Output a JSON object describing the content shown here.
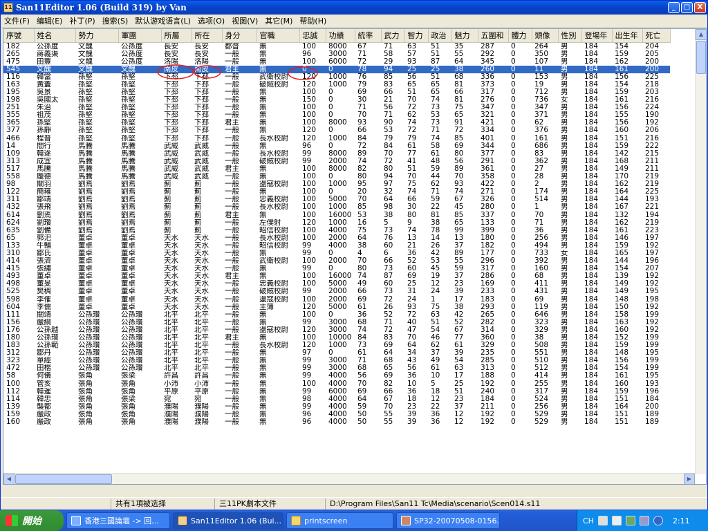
{
  "window": {
    "title": "San11Editor 1.06 (Build 319) by Van",
    "icon_text": "11",
    "buttons": [
      "_",
      "□",
      "X"
    ]
  },
  "menu": [
    "文件(F)",
    "编辑(E)",
    "补丁(P)",
    "搜索(S)",
    "默认游戏语言(L)",
    "选项(O)",
    "视图(V)",
    "其它(M)",
    "帮助(H)"
  ],
  "columns": [
    "序號",
    "姓名",
    "勢力",
    "軍團",
    "所屬",
    "所在",
    "身分",
    "官職",
    "忠誠",
    "功績",
    "統率",
    "武力",
    "智力",
    "政治",
    "魅力",
    "五圍和",
    "體力",
    "頭像",
    "性別",
    "登場年",
    "出生年",
    "死亡"
  ],
  "rows": [
    [
      "182",
      "公孫度",
      "文醜",
      "公孫度",
      "長安",
      "長安",
      "都督",
      "無",
      "100",
      "8000",
      "67",
      "71",
      "63",
      "51",
      "35",
      "287",
      "0",
      "264",
      "男",
      "184",
      "154",
      "204"
    ],
    [
      "265",
      "蔣義渠",
      "文醜",
      "公孫度",
      "長安",
      "長安",
      "一般",
      "無",
      "96",
      "3000",
      "71",
      "58",
      "57",
      "51",
      "55",
      "292",
      "0",
      "350",
      "男",
      "184",
      "159",
      "205"
    ],
    [
      "475",
      "田豐",
      "文醜",
      "公孫度",
      "洛陽",
      "洛陽",
      "一般",
      "無",
      "100",
      "6000",
      "72",
      "29",
      "93",
      "87",
      "64",
      "345",
      "0",
      "107",
      "男",
      "184",
      "162",
      "200"
    ],
    [
      "545",
      "文醜",
      "文醜",
      "文醜",
      "南皮",
      "南皮",
      "君主",
      "無",
      "0",
      "0",
      "78",
      "94",
      "25",
      "25",
      "38",
      "260",
      "0",
      "11",
      "男",
      "184",
      "161",
      "200"
    ],
    [
      "116",
      "韓當",
      "孫堅",
      "孫堅",
      "下邳",
      "下邳",
      "一般",
      "武衛校尉",
      "120",
      "1000",
      "76",
      "85",
      "56",
      "51",
      "68",
      "336",
      "0",
      "153",
      "男",
      "184",
      "156",
      "225"
    ],
    [
      "163",
      "黃蓋",
      "孫堅",
      "孫堅",
      "下邳",
      "下邳",
      "一般",
      "破賊校尉",
      "120",
      "1000",
      "79",
      "83",
      "65",
      "65",
      "81",
      "373",
      "0",
      "19",
      "男",
      "184",
      "154",
      "218"
    ],
    [
      "195",
      "吳景",
      "孫堅",
      "孫堅",
      "下邳",
      "下邳",
      "一般",
      "無",
      "100",
      "0",
      "69",
      "66",
      "51",
      "65",
      "66",
      "317",
      "0",
      "712",
      "男",
      "184",
      "159",
      "203"
    ],
    [
      "198",
      "吳國太",
      "孫堅",
      "孫堅",
      "下邳",
      "下邳",
      "一般",
      "無",
      "150",
      "0",
      "30",
      "21",
      "70",
      "74",
      "81",
      "276",
      "0",
      "736",
      "女",
      "184",
      "161",
      "216"
    ],
    [
      "251",
      "朱治",
      "孫堅",
      "孫堅",
      "下邳",
      "下邳",
      "一般",
      "無",
      "100",
      "0",
      "71",
      "56",
      "72",
      "73",
      "75",
      "347",
      "0",
      "347",
      "男",
      "184",
      "156",
      "224"
    ],
    [
      "355",
      "祖茂",
      "孫堅",
      "孫堅",
      "下邳",
      "下邳",
      "一般",
      "無",
      "100",
      "0",
      "70",
      "71",
      "62",
      "53",
      "65",
      "321",
      "0",
      "371",
      "男",
      "184",
      "155",
      "190"
    ],
    [
      "365",
      "孫堅",
      "孫堅",
      "孫堅",
      "下邳",
      "下邳",
      "君主",
      "無",
      "100",
      "8000",
      "93",
      "90",
      "74",
      "73",
      "91",
      "421",
      "0",
      "62",
      "男",
      "184",
      "156",
      "192"
    ],
    [
      "377",
      "孫靜",
      "孫堅",
      "孫堅",
      "下邳",
      "下邳",
      "一般",
      "無",
      "120",
      "0",
      "66",
      "53",
      "72",
      "71",
      "72",
      "334",
      "0",
      "376",
      "男",
      "184",
      "160",
      "206"
    ],
    [
      "466",
      "程普",
      "孫堅",
      "孫堅",
      "下邳",
      "下邳",
      "一般",
      "長水校尉",
      "120",
      "1000",
      "84",
      "79",
      "79",
      "74",
      "85",
      "401",
      "0",
      "161",
      "男",
      "184",
      "151",
      "216"
    ],
    [
      "14",
      "閻行",
      "馬騰",
      "馬騰",
      "武威",
      "武威",
      "一般",
      "無",
      "96",
      "0",
      "72",
      "84",
      "61",
      "58",
      "69",
      "344",
      "0",
      "686",
      "男",
      "184",
      "159",
      "222"
    ],
    [
      "109",
      "韓遂",
      "馬騰",
      "馬騰",
      "武威",
      "武威",
      "一般",
      "長水校尉",
      "99",
      "8000",
      "89",
      "70",
      "77",
      "61",
      "80",
      "377",
      "0",
      "83",
      "男",
      "184",
      "142",
      "215"
    ],
    [
      "313",
      "成宜",
      "馬騰",
      "馬騰",
      "武威",
      "武威",
      "一般",
      "破賊校尉",
      "99",
      "2000",
      "74",
      "72",
      "41",
      "48",
      "56",
      "291",
      "0",
      "362",
      "男",
      "184",
      "168",
      "211"
    ],
    [
      "517",
      "馬騰",
      "馬騰",
      "馬騰",
      "武威",
      "武威",
      "君主",
      "無",
      "100",
      "8000",
      "82",
      "80",
      "51",
      "59",
      "89",
      "361",
      "0",
      "27",
      "男",
      "184",
      "149",
      "211"
    ],
    [
      "558",
      "龐德",
      "馬騰",
      "馬騰",
      "武威",
      "武威",
      "一般",
      "無",
      "100",
      "0",
      "80",
      "94",
      "70",
      "44",
      "70",
      "358",
      "0",
      "28",
      "男",
      "184",
      "170",
      "219"
    ],
    [
      "98",
      "關羽",
      "劉焉",
      "劉焉",
      "薊",
      "薊",
      "一般",
      "盪寇校尉",
      "100",
      "1000",
      "95",
      "97",
      "75",
      "62",
      "93",
      "422",
      "0",
      "2",
      "男",
      "184",
      "162",
      "219"
    ],
    [
      "122",
      "簡雍",
      "劉焉",
      "劉焉",
      "薊",
      "薊",
      "一般",
      "無",
      "100",
      "0",
      "20",
      "32",
      "74",
      "71",
      "74",
      "271",
      "0",
      "174",
      "男",
      "184",
      "164",
      "225"
    ],
    [
      "311",
      "鄒靖",
      "劉焉",
      "劉焉",
      "薊",
      "薊",
      "一般",
      "忠義校尉",
      "100",
      "5000",
      "70",
      "64",
      "66",
      "59",
      "67",
      "326",
      "0",
      "514",
      "男",
      "184",
      "144",
      "193"
    ],
    [
      "432",
      "張飛",
      "劉焉",
      "劉焉",
      "薊",
      "薊",
      "一般",
      "長水校尉",
      "100",
      "1000",
      "85",
      "98",
      "30",
      "22",
      "45",
      "280",
      "0",
      "1",
      "男",
      "184",
      "167",
      "221"
    ],
    [
      "614",
      "劉焉",
      "劉焉",
      "劉焉",
      "薊",
      "薊",
      "君主",
      "無",
      "100",
      "16000",
      "53",
      "38",
      "80",
      "81",
      "85",
      "337",
      "0",
      "70",
      "男",
      "184",
      "132",
      "194"
    ],
    [
      "624",
      "劉瓚",
      "劉焉",
      "劉焉",
      "薊",
      "薊",
      "一般",
      "左僕射",
      "120",
      "1000",
      "16",
      "5",
      "9",
      "38",
      "65",
      "133",
      "0",
      "71",
      "男",
      "184",
      "162",
      "219"
    ],
    [
      "635",
      "劉備",
      "劉焉",
      "劉焉",
      "薊",
      "薊",
      "一般",
      "昭信校尉",
      "100",
      "4000",
      "75",
      "73",
      "74",
      "78",
      "99",
      "399",
      "0",
      "36",
      "男",
      "184",
      "161",
      "223"
    ],
    [
      "65",
      "郭汜",
      "董卓",
      "董卓",
      "天水",
      "天水",
      "一般",
      "長水校尉",
      "100",
      "2000",
      "64",
      "76",
      "13",
      "14",
      "13",
      "180",
      "0",
      "256",
      "男",
      "184",
      "146",
      "197"
    ],
    [
      "133",
      "牛輔",
      "董卓",
      "董卓",
      "天水",
      "天水",
      "一般",
      "昭信校尉",
      "99",
      "4000",
      "38",
      "60",
      "21",
      "26",
      "37",
      "182",
      "0",
      "494",
      "男",
      "184",
      "159",
      "192"
    ],
    [
      "310",
      "鄒氏",
      "董卓",
      "董卓",
      "天水",
      "天水",
      "一般",
      "無",
      "99",
      "0",
      "4",
      "6",
      "36",
      "42",
      "89",
      "177",
      "0",
      "733",
      "女",
      "184",
      "165",
      "197"
    ],
    [
      "414",
      "張濟",
      "董卓",
      "董卓",
      "天水",
      "天水",
      "一般",
      "武衛校尉",
      "100",
      "2000",
      "70",
      "66",
      "52",
      "53",
      "55",
      "296",
      "0",
      "392",
      "男",
      "184",
      "144",
      "196"
    ],
    [
      "415",
      "張繡",
      "董卓",
      "董卓",
      "天水",
      "天水",
      "一般",
      "無",
      "99",
      "0",
      "80",
      "73",
      "60",
      "45",
      "59",
      "317",
      "0",
      "160",
      "男",
      "184",
      "154",
      "207"
    ],
    [
      "493",
      "董卓",
      "董卓",
      "董卓",
      "天水",
      "天水",
      "君主",
      "無",
      "100",
      "16000",
      "74",
      "87",
      "69",
      "19",
      "37",
      "286",
      "0",
      "68",
      "男",
      "184",
      "139",
      "192"
    ],
    [
      "498",
      "董旻",
      "董卓",
      "董卓",
      "天水",
      "天水",
      "一般",
      "忠義校尉",
      "100",
      "5000",
      "49",
      "60",
      "25",
      "12",
      "23",
      "169",
      "0",
      "411",
      "男",
      "184",
      "149",
      "192"
    ],
    [
      "525",
      "樊稠",
      "董卓",
      "董卓",
      "天水",
      "天水",
      "一般",
      "破賊校尉",
      "99",
      "2000",
      "66",
      "73",
      "31",
      "24",
      "39",
      "233",
      "0",
      "431",
      "男",
      "184",
      "149",
      "195"
    ],
    [
      "598",
      "李傕",
      "董卓",
      "董卓",
      "天水",
      "天水",
      "一般",
      "盪寇校尉",
      "100",
      "2000",
      "69",
      "72",
      "24",
      "1",
      "17",
      "183",
      "0",
      "69",
      "男",
      "184",
      "148",
      "198"
    ],
    [
      "604",
      "李儒",
      "董卓",
      "董卓",
      "天水",
      "天水",
      "一般",
      "主簿",
      "120",
      "5000",
      "61",
      "26",
      "93",
      "75",
      "38",
      "293",
      "0",
      "119",
      "男",
      "184",
      "150",
      "192"
    ],
    [
      "111",
      "關靖",
      "公孫瓚",
      "公孫瓚",
      "北平",
      "北平",
      "一般",
      "無",
      "100",
      "0",
      "36",
      "52",
      "72",
      "63",
      "42",
      "265",
      "0",
      "646",
      "男",
      "184",
      "158",
      "199"
    ],
    [
      "156",
      "嚴綱",
      "公孫瓚",
      "公孫瓚",
      "北平",
      "北平",
      "一般",
      "無",
      "99",
      "3000",
      "68",
      "71",
      "40",
      "51",
      "52",
      "282",
      "0",
      "323",
      "男",
      "184",
      "163",
      "192"
    ],
    [
      "176",
      "公孫越",
      "公孫瓚",
      "公孫瓚",
      "北平",
      "北平",
      "一般",
      "盪寇校尉",
      "120",
      "3000",
      "74",
      "72",
      "47",
      "54",
      "67",
      "314",
      "0",
      "329",
      "男",
      "184",
      "160",
      "192"
    ],
    [
      "180",
      "公孫瓚",
      "公孫瓚",
      "公孫瓚",
      "北平",
      "北平",
      "君主",
      "無",
      "100",
      "10000",
      "84",
      "83",
      "70",
      "46",
      "77",
      "360",
      "0",
      "38",
      "男",
      "184",
      "152",
      "199"
    ],
    [
      "183",
      "公孫範",
      "公孫瓚",
      "公孫瓚",
      "北平",
      "北平",
      "一般",
      "長水校尉",
      "120",
      "1000",
      "73",
      "69",
      "64",
      "62",
      "61",
      "329",
      "0",
      "508",
      "男",
      "184",
      "159",
      "199"
    ],
    [
      "312",
      "鄒丹",
      "公孫瓚",
      "公孫瓚",
      "北平",
      "北平",
      "一般",
      "無",
      "97",
      "0",
      "61",
      "64",
      "34",
      "37",
      "39",
      "235",
      "0",
      "551",
      "男",
      "184",
      "148",
      "195"
    ],
    [
      "323",
      "單經",
      "公孫瓚",
      "公孫瓚",
      "北平",
      "北平",
      "一般",
      "無",
      "99",
      "3000",
      "71",
      "68",
      "43",
      "49",
      "54",
      "285",
      "0",
      "510",
      "男",
      "184",
      "156",
      "199"
    ],
    [
      "472",
      "田楷",
      "公孫瓚",
      "公孫瓚",
      "北平",
      "北平",
      "一般",
      "無",
      "99",
      "3000",
      "68",
      "65",
      "56",
      "61",
      "63",
      "313",
      "0",
      "512",
      "男",
      "184",
      "154",
      "199"
    ],
    [
      "58",
      "何儀",
      "張角",
      "張梁",
      "許昌",
      "許昌",
      "一般",
      "無",
      "99",
      "4000",
      "56",
      "69",
      "36",
      "10",
      "17",
      "188",
      "0",
      "414",
      "男",
      "184",
      "161",
      "195"
    ],
    [
      "100",
      "管亥",
      "張角",
      "張角",
      "小沛",
      "小沛",
      "一般",
      "無",
      "100",
      "4000",
      "70",
      "82",
      "10",
      "5",
      "25",
      "192",
      "0",
      "255",
      "男",
      "184",
      "160",
      "193"
    ],
    [
      "112",
      "韓暹",
      "張角",
      "張角",
      "平原",
      "平原",
      "一般",
      "無",
      "99",
      "6000",
      "69",
      "66",
      "36",
      "18",
      "51",
      "240",
      "0",
      "317",
      "男",
      "184",
      "159",
      "196"
    ],
    [
      "114",
      "韓忠",
      "張角",
      "張梁",
      "宛",
      "宛",
      "一般",
      "無",
      "98",
      "4000",
      "64",
      "67",
      "18",
      "12",
      "23",
      "184",
      "0",
      "524",
      "男",
      "184",
      "151",
      "184"
    ],
    [
      "139",
      "襲都",
      "張角",
      "張角",
      "濮陽",
      "濮陽",
      "一般",
      "無",
      "99",
      "4000",
      "59",
      "70",
      "23",
      "22",
      "37",
      "211",
      "0",
      "256",
      "男",
      "184",
      "164",
      "200"
    ],
    [
      "159",
      "嚴政",
      "張角",
      "張角",
      "濮陽",
      "濮陽",
      "一般",
      "無",
      "96",
      "4000",
      "50",
      "55",
      "39",
      "36",
      "12",
      "192",
      "0",
      "529",
      "男",
      "184",
      "151",
      "189"
    ],
    [
      "160",
      "嚴政",
      "張角",
      "張角",
      "濮陽",
      "濮陽",
      "一般",
      "無",
      "96",
      "4000",
      "50",
      "55",
      "39",
      "36",
      "12",
      "192",
      "0",
      "529",
      "男",
      "184",
      "151",
      "189"
    ]
  ],
  "selected_row": 3,
  "status": [
    "共有1項被选择",
    "三11PK劇本文件",
    "D:\\Program Files\\San11 Tc\\Media\\scenario\\Scen014.s11"
  ],
  "taskbar": {
    "start": "開始",
    "tasks": [
      "香港三國論壇 -> 回...",
      "San11Editor 1.06 (Bui...",
      "printscreen",
      "SP32-20070508-0156..."
    ],
    "tray_lang": "CH",
    "clock": "2:11"
  },
  "colors": {
    "selection": "#316ac5",
    "title_bar": "#0842c8",
    "annotation_circle": "#e02020"
  }
}
